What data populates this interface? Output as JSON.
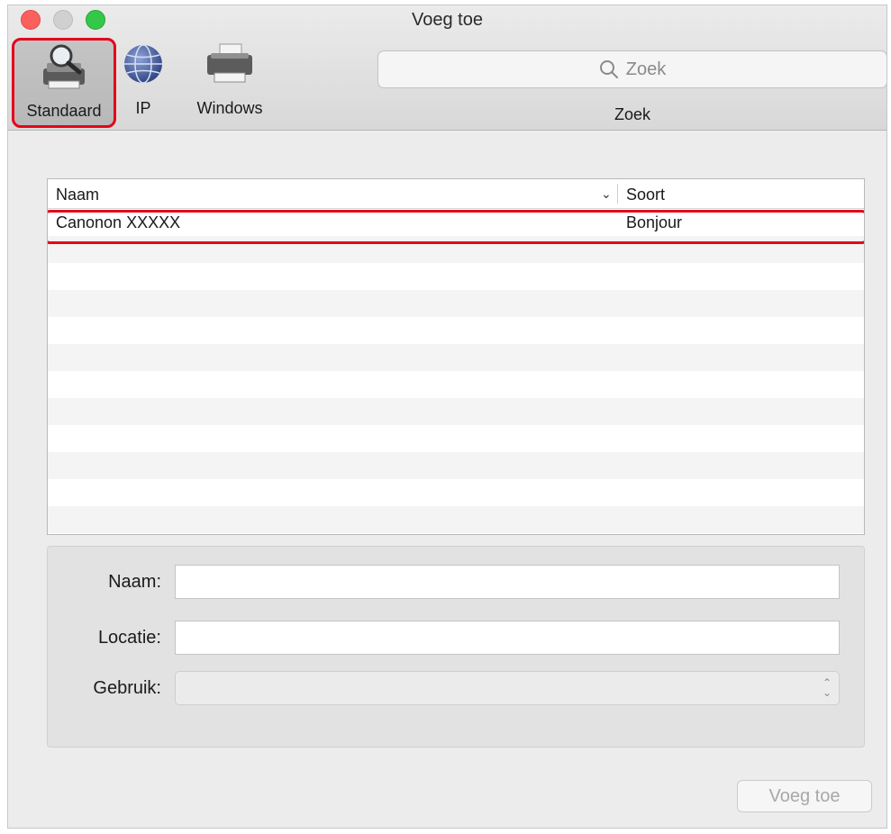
{
  "window": {
    "title": "Voeg toe"
  },
  "toolbar": {
    "items": [
      {
        "label": "Standaard",
        "icon": "printer-magnifier-icon",
        "selected": true
      },
      {
        "label": "IP",
        "icon": "globe-icon",
        "selected": false
      },
      {
        "label": "Windows",
        "icon": "printer-icon",
        "selected": false
      }
    ],
    "search": {
      "placeholder": "Zoek",
      "caption": "Zoek"
    }
  },
  "printer_list": {
    "columns": {
      "name": "Naam",
      "kind": "Soort"
    },
    "rows": [
      {
        "name": "Canonon XXXXX",
        "kind": "Bonjour",
        "highlighted": true
      }
    ]
  },
  "info": {
    "name_label": "Naam:",
    "name_value": "",
    "location_label": "Locatie:",
    "location_value": "",
    "use_label": "Gebruik:",
    "use_value": ""
  },
  "footer": {
    "add_button": "Voeg toe"
  },
  "colors": {
    "highlight": "#e3051b",
    "close": "#fc605c",
    "zoom": "#34c84a"
  }
}
